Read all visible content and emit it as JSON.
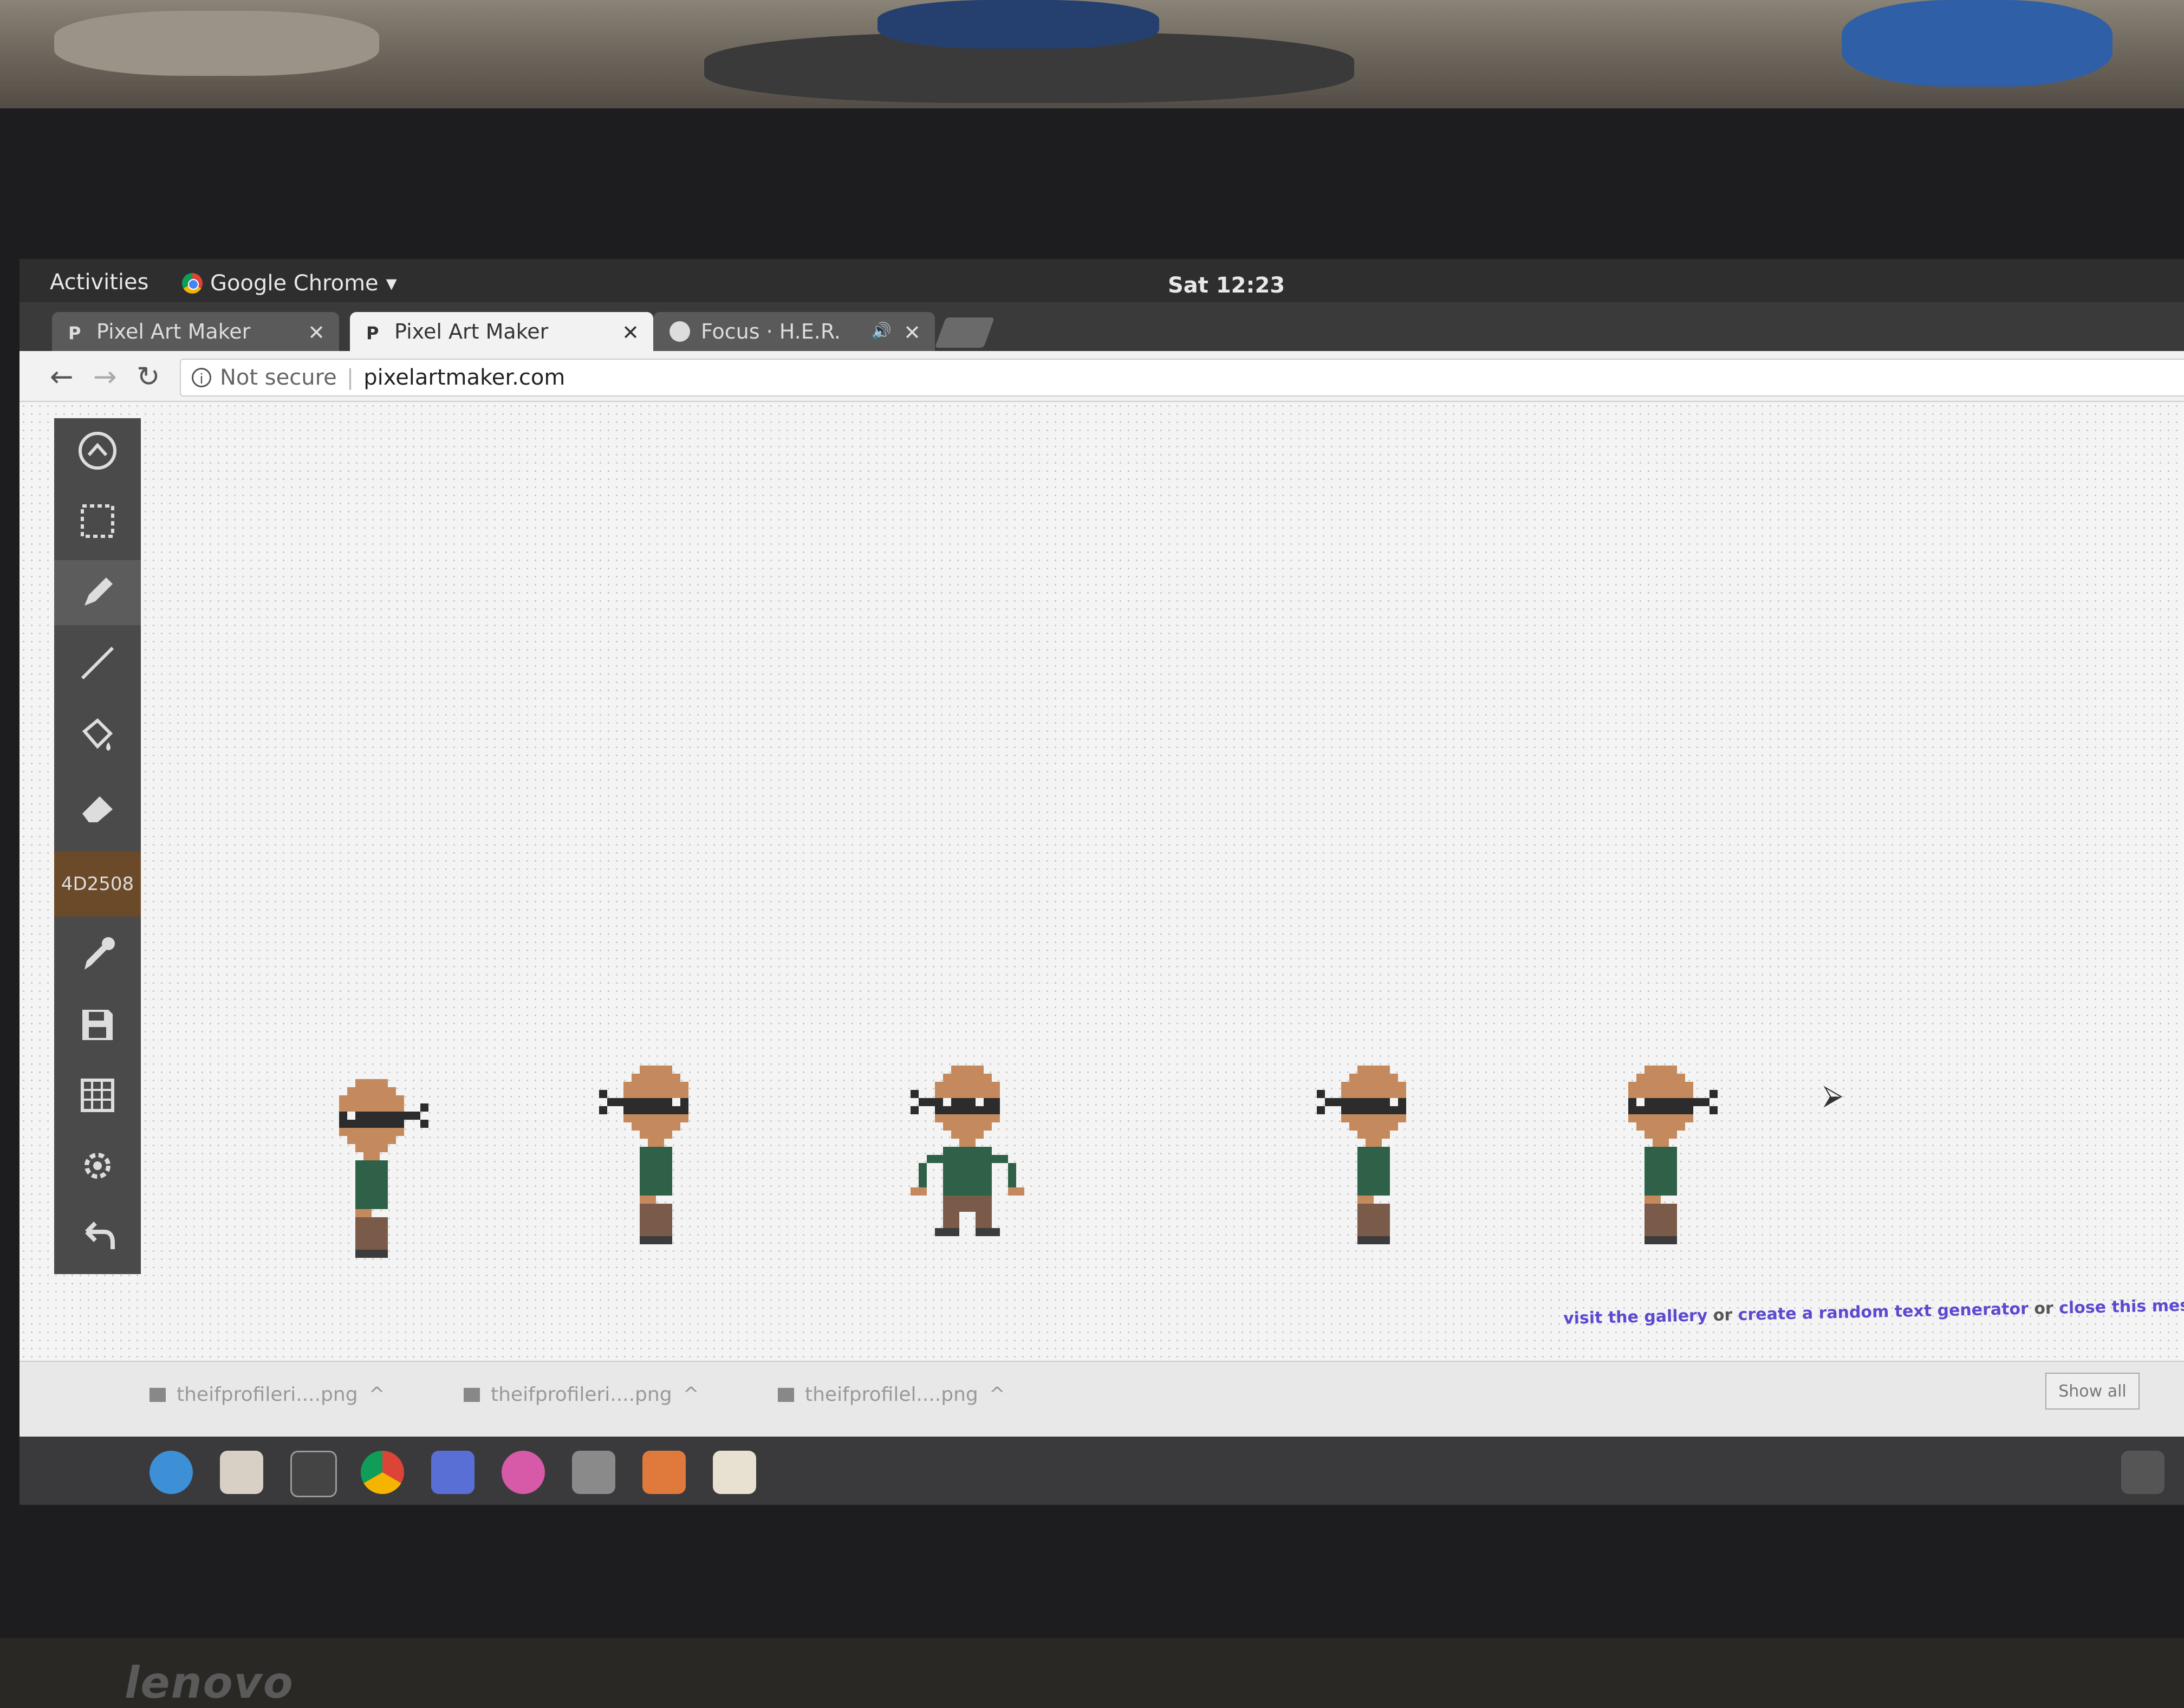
{
  "topbar": {
    "activities": "Activities",
    "app_name": "Google Chrome",
    "clock": "Sat 12:23"
  },
  "tabs": [
    {
      "label": "Pixel Art Maker",
      "active": false
    },
    {
      "label": "Pixel Art Maker",
      "active": true
    },
    {
      "label": "Focus · H.E.R.",
      "active": false
    }
  ],
  "address_bar": {
    "security": "Not secure",
    "url": "pixelartmaker.com"
  },
  "tools": [
    "up-icon",
    "select-icon",
    "pencil-icon",
    "line-icon",
    "fill-icon",
    "eraser-icon",
    "eyedropper-icon",
    "save-icon",
    "grid-icon",
    "gear-icon",
    "undo-icon"
  ],
  "current_color": {
    "hex_label": "4D2508"
  },
  "colors": {
    "skin": "#c48a5e",
    "mask": "#2c2c2c",
    "eye": "#f4f4f4",
    "shirt": "#2e6148",
    "pants": "#7a5a48",
    "shoe": "#3c3c3c"
  },
  "banner": {
    "link1": "visit the gallery",
    "or1": "or",
    "link2": "create a random text generator",
    "or2": "or",
    "link3": "close this messag"
  },
  "downloads": [
    {
      "name": "theifprofileri....png"
    },
    {
      "name": "theifprofileri....png"
    },
    {
      "name": "theifprofilel....png"
    }
  ],
  "downloads_show_all": "Show all",
  "laptop_brand": "lenovo"
}
